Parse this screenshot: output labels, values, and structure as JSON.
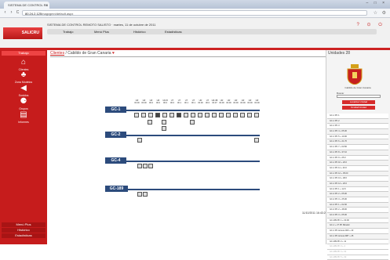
{
  "browser": {
    "tab_title": "SISTEMA DE CONTROL RE",
    "tab_close": "×",
    "window_buttons": "– □ ×",
    "back": "‹",
    "forward": "›",
    "reload": "C",
    "url_host": "80.24.2.125",
    "url_path": "/nagvgmn/default.aspx",
    "star": "☆",
    "wrench": "⚙"
  },
  "app": {
    "title": "SISTEMA DE CONTROL REMOTO SALISTO · martes, 11 de octubre de 2011",
    "logo": "SALICRU",
    "menu": [
      "Trabajo",
      "Menú Plus",
      "Histórico",
      "Estadísticas"
    ],
    "header_icons": "? ⊙ ⏻"
  },
  "sidebar": {
    "header": "Trabajo",
    "items": [
      {
        "label": "Clientes",
        "icon": "home-icon",
        "glyph": "⌂"
      },
      {
        "label": "Zona Modelos",
        "icon": "tree-icon",
        "glyph": "♣"
      },
      {
        "label": "Sonidos",
        "icon": "speaker-icon",
        "glyph": "◀"
      },
      {
        "label": "Grupos",
        "icon": "group-icon",
        "glyph": "⚈"
      },
      {
        "label": "Informes",
        "icon": "report-icon",
        "glyph": "▤"
      }
    ],
    "bottom": [
      "Menú Plus",
      "Histórico",
      "Estadísticas"
    ]
  },
  "breadcrumb": {
    "link": "Clientes",
    "separator": "/",
    "current": "Cabildo de Gran Canaria",
    "icon": "♥"
  },
  "groups": [
    {
      "label": "GC-1"
    },
    {
      "label": "GC-2"
    },
    {
      "label": "GC-4"
    },
    {
      "label": "GC-189"
    }
  ],
  "gc1_slots": [
    {
      "top": "UR",
      "bot": "00.00"
    },
    {
      "top": "UR",
      "bot": "00.00"
    },
    {
      "top": "UR",
      "bot": "00.0"
    },
    {
      "top": "UR",
      "bot": "00.0"
    },
    {
      "top": "UR-B",
      "bot": "00.0"
    },
    {
      "top": "UT",
      "bot": "00.0"
    },
    {
      "top": "UT",
      "bot": "00.1"
    },
    {
      "top": "UT",
      "bot": "00.1"
    },
    {
      "top": "UT",
      "bot": "00.1"
    },
    {
      "top": "UR",
      "bot": "00.00"
    },
    {
      "top": "UT",
      "bot": "00.0"
    },
    {
      "top": "UR-3B",
      "bot": "00.37"
    },
    {
      "top": "UR",
      "bot": "00.00"
    },
    {
      "top": "UR",
      "bot": "00.00"
    },
    {
      "top": "UR",
      "bot": "00.00"
    },
    {
      "top": "UR",
      "bot": "00.00"
    },
    {
      "top": "UR",
      "bot": "00.00"
    },
    {
      "top": "UR",
      "bot": "00.00"
    }
  ],
  "timestamp": "11/10/2011 16:43:25",
  "right_panel": {
    "title": "Unidades 28",
    "crest_caption": "Cabildo de Gran Canaria",
    "search_label": "Buscar",
    "search_value": "",
    "btn_locate": "Localizar Unidad",
    "btn_filter": "Ocultar/Unidad",
    "units": [
      "GC-1 PK 1",
      "GC-1 PK 2",
      "GC-1 PK 3",
      "GC-1 PK 4 + 05.30",
      "GC-1 PK 5 + 10.00",
      "GC-1 PK 6 + 21.70",
      "GC-1 PK 7 + 03.50",
      "GC-1 PK 8 + 37.10",
      "GC-1 PK 9 + 25.0",
      "GC-1 PK 10 + 20.0",
      "GC-1 PK 11 + 20.0",
      "GC-1 PK 12 + 35.00",
      "GC-1 PK 13 + 48.0",
      "GC-1 PK 14 + 20.0",
      "GC-2 PK 1 + 12.9",
      "GC-2 PK 2 + 05.00",
      "GC-2 PK 3 + 25.00",
      "GC-4 PK 1 + 02.00",
      "GC-4 PK 2 + 48.00",
      "GC-4 PK 3 + 05.00",
      "GC-189 PK 1 + 03.00",
      "GC-1 + 27 PK Mirador",
      "GC-1 PK Acceso 900 + 43",
      "GC-1 PK Acceso 887 + 25",
      "GC-189 PK 2 + 11",
      "GC-189 PK 3 + 4",
      "GC-189 PK 4 + 01",
      "GC-189 PK 5 + 02"
    ]
  }
}
